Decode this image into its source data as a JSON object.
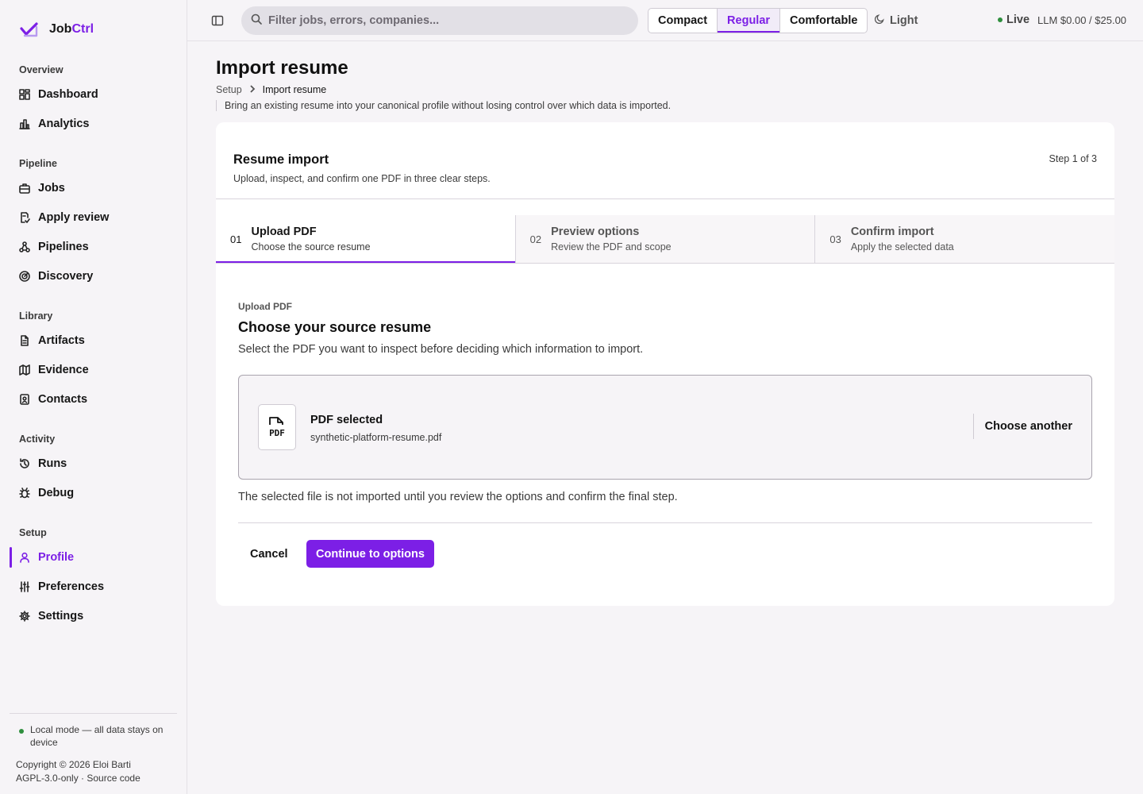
{
  "brand": {
    "name_prefix": "Job",
    "name_accent": "Ctrl"
  },
  "sidebar": {
    "sections": [
      {
        "label": "Overview"
      },
      {
        "label": "Pipeline"
      },
      {
        "label": "Library"
      },
      {
        "label": "Activity"
      },
      {
        "label": "Setup"
      }
    ],
    "items": [
      {
        "label": "Dashboard",
        "icon": "dashboard-icon"
      },
      {
        "label": "Analytics",
        "icon": "bar-chart-icon"
      },
      {
        "label": "Jobs",
        "icon": "briefcase-icon"
      },
      {
        "label": "Apply review",
        "icon": "clipboard-check-icon"
      },
      {
        "label": "Pipelines",
        "icon": "workflow-icon"
      },
      {
        "label": "Discovery",
        "icon": "radar-icon"
      },
      {
        "label": "Artifacts",
        "icon": "document-icon"
      },
      {
        "label": "Evidence",
        "icon": "map-icon"
      },
      {
        "label": "Contacts",
        "icon": "contact-card-icon"
      },
      {
        "label": "Runs",
        "icon": "history-icon"
      },
      {
        "label": "Debug",
        "icon": "bug-icon"
      },
      {
        "label": "Profile",
        "icon": "user-icon",
        "active": true
      },
      {
        "label": "Preferences",
        "icon": "sliders-icon"
      },
      {
        "label": "Settings",
        "icon": "gear-icon"
      }
    ],
    "footer": {
      "local_mode": "Local mode — all data stays on device",
      "copyright": "Copyright © 2026 Eloi Barti",
      "license": "AGPL-3.0-only · Source code"
    }
  },
  "topbar": {
    "search_placeholder": "Filter jobs, errors, companies...",
    "density": [
      "Compact",
      "Regular",
      "Comfortable"
    ],
    "density_selected": "Regular",
    "theme_label": "Light",
    "live_label": "Live",
    "llm_budget": "LLM $0.00 / $25.00"
  },
  "page": {
    "title": "Import resume",
    "breadcrumb": [
      "Setup",
      "Import resume"
    ],
    "description": "Bring an existing resume into your canonical profile without losing control over which data is imported."
  },
  "card": {
    "title": "Resume import",
    "subtitle": "Upload, inspect, and confirm one PDF in three clear steps.",
    "step_count": "Step 1 of 3",
    "steps": [
      {
        "num": "01",
        "name": "Upload PDF",
        "desc": "Choose the source resume",
        "active": true
      },
      {
        "num": "02",
        "name": "Preview options",
        "desc": "Review the PDF and scope"
      },
      {
        "num": "03",
        "name": "Confirm import",
        "desc": "Apply the selected data"
      }
    ],
    "upload": {
      "eyebrow": "Upload PDF",
      "title": "Choose your source resume",
      "description": "Select the PDF you want to inspect before deciding which information to import.",
      "file_status": "PDF selected",
      "file_name": "synthetic-platform-resume.pdf",
      "file_icon_text": "PDF",
      "choose_another": "Choose another",
      "note": "The selected file is not imported until you review the options and confirm the final step."
    },
    "actions": {
      "cancel": "Cancel",
      "continue": "Continue to options"
    }
  },
  "colors": {
    "accent": "#7c1fe6",
    "live": "#2f8f3e"
  }
}
